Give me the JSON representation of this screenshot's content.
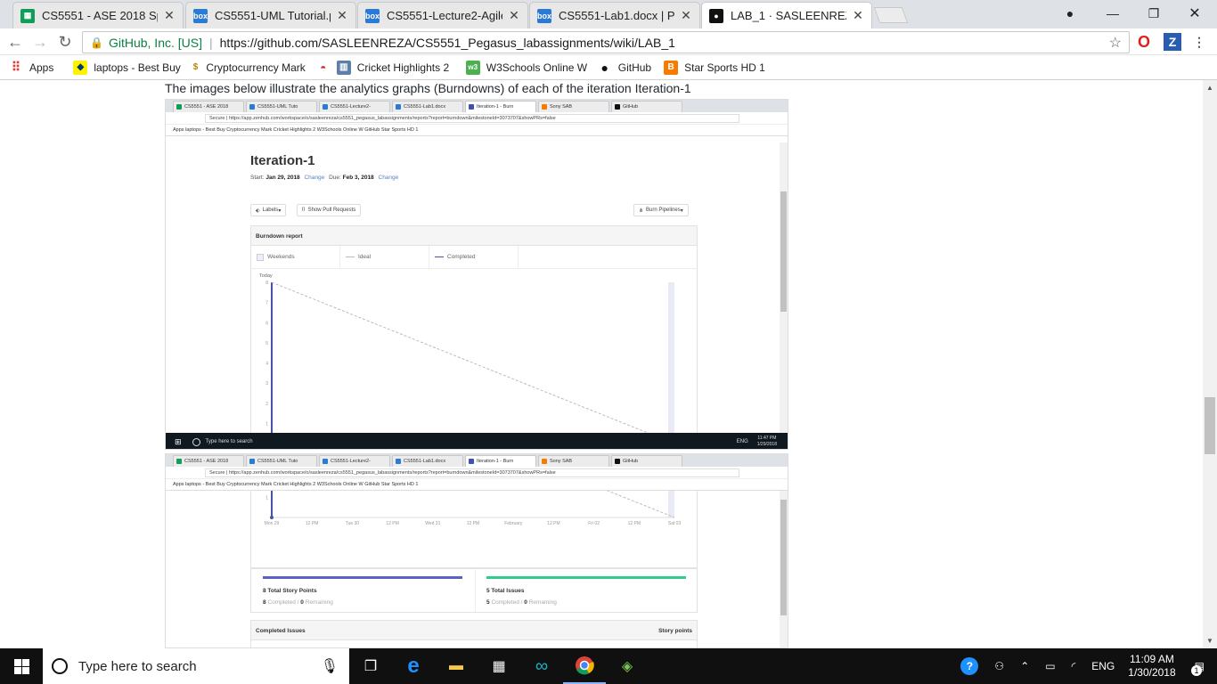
{
  "browser": {
    "tabs": [
      {
        "label": "CS5551 - ASE 2018 Sprin",
        "icon": "sheets-icon",
        "color": "#0f9d58"
      },
      {
        "label": "CS5551-UML Tutorial.ppt",
        "icon": "box-icon",
        "color": "#2b7bd4"
      },
      {
        "label": "CS5551-Lecture2-Agile P",
        "icon": "box-icon",
        "color": "#2b7bd4"
      },
      {
        "label": "CS5551-Lab1.docx | Pow",
        "icon": "box-icon",
        "color": "#2b7bd4"
      },
      {
        "label": "LAB_1 · SASLEENREZA/C",
        "icon": "github-icon",
        "color": "#111111"
      }
    ],
    "omnibox": {
      "org": "GitHub, Inc. [US]",
      "url": "https://github.com/SASLEENREZA/CS5551_Pegasus_labassignments/wiki/LAB_1"
    },
    "bookmarks": [
      {
        "label": "Apps",
        "icon": "apps-grid-icon"
      },
      {
        "label": "laptops - Best Buy",
        "icon": "bestbuy-icon"
      },
      {
        "label": "Cryptocurrency Mark",
        "icon": "coin-icon"
      },
      {
        "label": "Cricket Highlights 2",
        "icon": "cricket-icon"
      },
      {
        "label": "W3Schools Online W",
        "icon": "w3schools-icon"
      },
      {
        "label": "GitHub",
        "icon": "github-icon"
      },
      {
        "label": "Star Sports HD 1",
        "icon": "blogger-icon"
      }
    ]
  },
  "page": {
    "caption": "The images below illustrate the analytics graphs (Burndowns) of each of the iteration Iteration-1"
  },
  "shot1": {
    "tabs": [
      "CS5551 - ASE 2018",
      "CS5551-UML Tuto",
      "CS5551-Lecture2-",
      "CS5551-Lab1.docx",
      "Iteration-1 - Burn",
      "Sony SAB",
      "GitHub"
    ],
    "url": "Secure  |  https://app.zenhub.com/workspace/o/sasleenreza/cs5551_pegasus_labassignments/reports?report=burndown&milestoneId=3073707&showPRs=false",
    "bookmarks": "Apps    laptops - Best Buy    Cryptocurrency Mark    Cricket Highlights 2    W3Schools Online W    GitHub    Star Sports HD 1",
    "title": "Iteration-1",
    "start_label": "Start:",
    "start_date": "Jan 29, 2018",
    "due_label": "Due:",
    "due_date": "Feb 3, 2018",
    "change": "Change",
    "labels_btn": "Labels",
    "prs_btn": "Show Pull Requests",
    "pipelines_btn": "Burn Pipelines",
    "report_title": "Burndown report",
    "legend": [
      "Weekends",
      "Ideal",
      "Completed"
    ],
    "today": "Today",
    "taskbar_search": "Type here to search",
    "taskbar_time": "11:47 PM",
    "taskbar_date": "1/29/2018",
    "taskbar_lang": "ENG"
  },
  "chart_data": {
    "type": "line",
    "title": "Burndown report",
    "x": [
      "Mon 29",
      "12 PM",
      "Tue 30",
      "12 PM",
      "Wed 31",
      "12 PM",
      "February",
      "12 PM",
      "Fri 02",
      "12 PM",
      "Sat 03"
    ],
    "y_ticks": [
      8,
      7,
      6,
      5,
      4,
      3,
      2,
      1
    ],
    "ylim": [
      0,
      8
    ],
    "series": [
      {
        "name": "Ideal",
        "values": [
          8,
          0
        ]
      },
      {
        "name": "Completed",
        "values": [
          8,
          0
        ]
      }
    ]
  },
  "shot2": {
    "total_points": "8 Total Story Points",
    "points_completed": "8",
    "points_remaining": "0",
    "total_issues": "5 Total Issues",
    "issues_completed": "5",
    "issues_remaining": "0",
    "completed_word": "Completed /",
    "remaining_word": "Remaining",
    "completed_issues": "Completed Issues",
    "story_points": "Story points"
  },
  "taskbar": {
    "search": "Type here to search",
    "lang": "ENG",
    "time": "11:09 AM",
    "date": "1/30/2018",
    "notification_count": "1"
  }
}
